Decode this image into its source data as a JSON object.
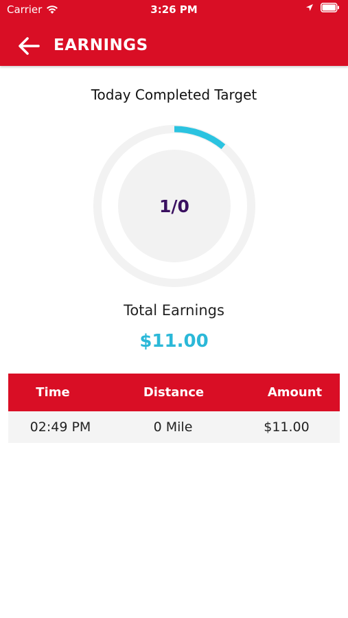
{
  "status_bar": {
    "carrier": "Carrier",
    "time": "3:26 PM",
    "icons": [
      "wifi-icon",
      "location-arrow-icon",
      "battery-icon"
    ]
  },
  "header": {
    "title": "EARNINGS",
    "back_icon": "arrow-left-icon",
    "color": "#d90e25"
  },
  "target": {
    "title": "Today Completed Target",
    "value": "1/0",
    "progress_fraction": 0.11,
    "progress_color": "#2bc3e0",
    "track_color": "#f2f2f2"
  },
  "earnings": {
    "label": "Total Earnings",
    "value": "$11.00",
    "color": "#2bb8d8"
  },
  "table": {
    "headers": [
      "Time",
      "Distance",
      "Amount"
    ],
    "rows": [
      [
        "02:49 PM",
        "0 Mile",
        "$11.00"
      ]
    ]
  }
}
